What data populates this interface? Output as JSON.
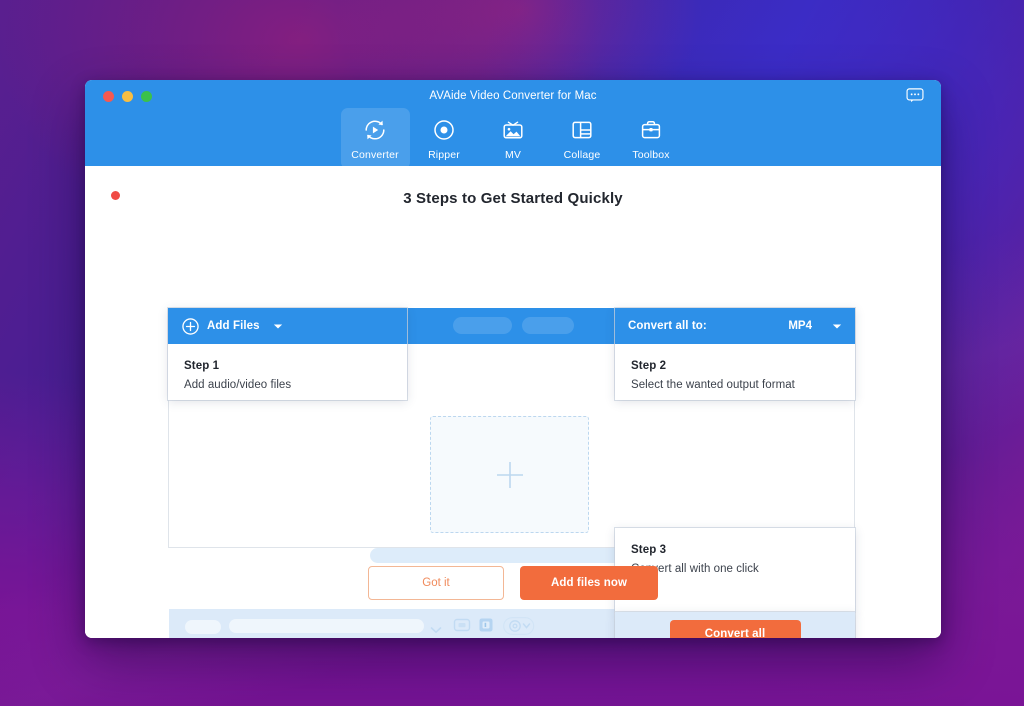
{
  "desktop": {
    "wallpaper_colors": [
      "#4a1f94",
      "#3a2bbd",
      "#7c1a93",
      "#b41e6e"
    ]
  },
  "window": {
    "title": "AVAide Video Converter for Mac",
    "traffic_lights": [
      {
        "name": "close",
        "color": "#f65951"
      },
      {
        "name": "minimize",
        "color": "#f8be42"
      },
      {
        "name": "maximize",
        "color": "#3bc14a"
      }
    ],
    "feedback_icon": "chat-bubble-icon",
    "accent_blue": "#2d90e8",
    "accent_orange": "#f26c3d"
  },
  "nav": {
    "items": [
      {
        "label": "Converter",
        "icon": "convert-circle-icon",
        "active": true
      },
      {
        "label": "Ripper",
        "icon": "disc-icon",
        "active": false
      },
      {
        "label": "MV",
        "icon": "tv-photo-icon",
        "active": false
      },
      {
        "label": "Collage",
        "icon": "layout-grid-icon",
        "active": false
      },
      {
        "label": "Toolbox",
        "icon": "briefcase-icon",
        "active": false
      }
    ]
  },
  "content": {
    "headline": "3 Steps to Get Started Quickly",
    "status_dot_color": "#f04b45"
  },
  "steps": [
    {
      "id": "step1",
      "title": "Step 1",
      "description": "Add audio/video files",
      "header": {
        "label": "Add Files",
        "icon": "plus-circle-icon",
        "caret": "chevron-down-icon"
      }
    },
    {
      "id": "step2",
      "title": "Step 2",
      "description": "Select the wanted output format",
      "header": {
        "label": "Convert all to:",
        "format_value": "MP4",
        "caret": "chevron-down-icon"
      }
    },
    {
      "id": "step3",
      "title": "Step 3",
      "description": "Convert all with one click",
      "action_label": "Convert all"
    }
  ],
  "dropzone": {
    "icon": "plus-icon"
  },
  "bottom_toolbar": {
    "icons": [
      "chevron-down-icon",
      "folder-icon",
      "preview-chip-icon",
      "gear-icon"
    ]
  },
  "footer": {
    "got_it_label": "Got it",
    "add_files_now_label": "Add files now"
  }
}
